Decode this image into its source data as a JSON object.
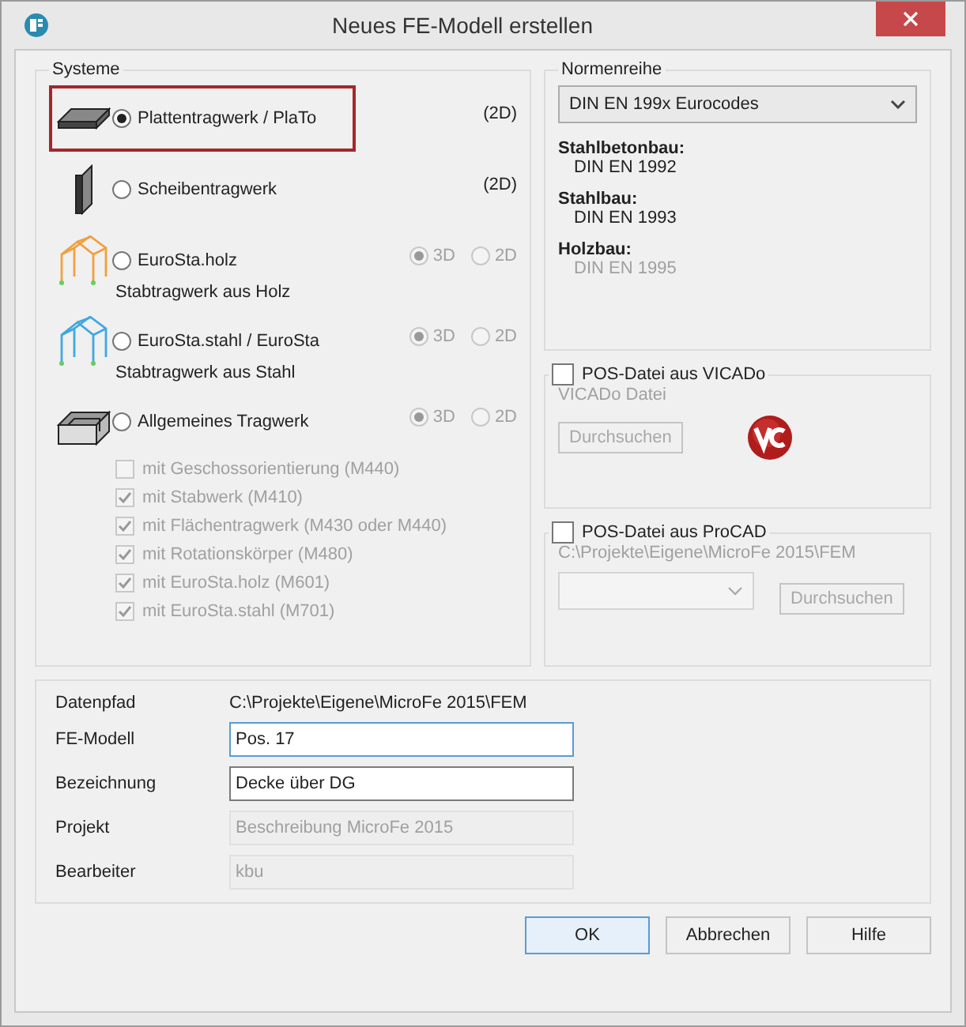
{
  "window": {
    "title": "Neues FE-Modell erstellen"
  },
  "systems": {
    "title": "Systeme",
    "items": [
      {
        "kind": "plate",
        "label": "Plattentragwerk  / PlaTo",
        "selected": true,
        "highlighted": true,
        "dimension": "(2D)"
      },
      {
        "kind": "wall",
        "label": "Scheibentragwerk",
        "selected": false,
        "highlighted": false,
        "dimension": "(2D)"
      },
      {
        "kind": "timber-frame",
        "label": "EuroSta.holz",
        "sublabel": "Stabtragwerk aus Holz",
        "selected": false,
        "highlighted": false,
        "modes": [
          {
            "label": "3D",
            "selected": true,
            "disabled": true
          },
          {
            "label": "2D",
            "selected": false,
            "disabled": true
          }
        ]
      },
      {
        "kind": "steel-frame",
        "label": "EuroSta.stahl / EuroSta",
        "sublabel": "Stabtragwerk aus Stahl",
        "selected": false,
        "highlighted": false,
        "modes": [
          {
            "label": "3D",
            "selected": true,
            "disabled": true
          },
          {
            "label": "2D",
            "selected": false,
            "disabled": true
          }
        ]
      },
      {
        "kind": "box",
        "label": "Allgemeines Tragwerk",
        "selected": false,
        "highlighted": false,
        "modes": [
          {
            "label": "3D",
            "selected": true,
            "disabled": true
          },
          {
            "label": "2D",
            "selected": false,
            "disabled": true
          }
        ]
      }
    ],
    "options": [
      {
        "label": "mit Geschossorientierung (M440)",
        "checked": false,
        "disabled": true
      },
      {
        "label": "mit Stabwerk (M410)",
        "checked": true,
        "disabled": true
      },
      {
        "label": "mit Flächentragwerk (M430 oder M440)",
        "checked": true,
        "disabled": true
      },
      {
        "label": "mit Rotationskörper (M480)",
        "checked": true,
        "disabled": true
      },
      {
        "label": "mit EuroSta.holz (M601)",
        "checked": true,
        "disabled": true
      },
      {
        "label": "mit EuroSta.stahl (M701)",
        "checked": true,
        "disabled": true
      }
    ]
  },
  "norms": {
    "title": "Normenreihe",
    "value": "DIN EN 199x Eurocodes",
    "groups": [
      {
        "heading": "Stahlbetonbau:",
        "norm": "DIN EN 1992",
        "disabled": false
      },
      {
        "heading": "Stahlbau:",
        "norm": "DIN EN 1993",
        "disabled": false
      },
      {
        "heading": "Holzbau:",
        "norm": "DIN EN 1995",
        "disabled": true
      }
    ]
  },
  "vicado": {
    "label": "POS-Datei aus VICADo",
    "checked": false,
    "file_label": "VICADo Datei",
    "button": "Durchsuchen",
    "disabled": true
  },
  "procad": {
    "label": "POS-Datei aus ProCAD",
    "checked": false,
    "path": "C:\\Projekte\\Eigene\\MicroFe 2015\\FEM",
    "button": "Durchsuchen",
    "disabled": true
  },
  "fields": [
    {
      "kind": "text",
      "label": "Datenpfad",
      "value": "C:\\Projekte\\Eigene\\MicroFe 2015\\FEM"
    },
    {
      "kind": "input",
      "label": "FE-Modell",
      "value": "Pos. 17",
      "focused": true,
      "disabled": false
    },
    {
      "kind": "input",
      "label": "Bezeichnung",
      "value": "Decke über DG",
      "focused": false,
      "disabled": false
    },
    {
      "kind": "input",
      "label": "Projekt",
      "value": "Beschreibung MicroFe 2015",
      "focused": false,
      "disabled": true
    },
    {
      "kind": "input",
      "label": "Bearbeiter",
      "value": "kbu",
      "focused": false,
      "disabled": true
    }
  ],
  "buttons": [
    {
      "label": "OK",
      "default": true
    },
    {
      "label": "Abbrechen",
      "default": false
    },
    {
      "label": "Hilfe",
      "default": false
    }
  ]
}
